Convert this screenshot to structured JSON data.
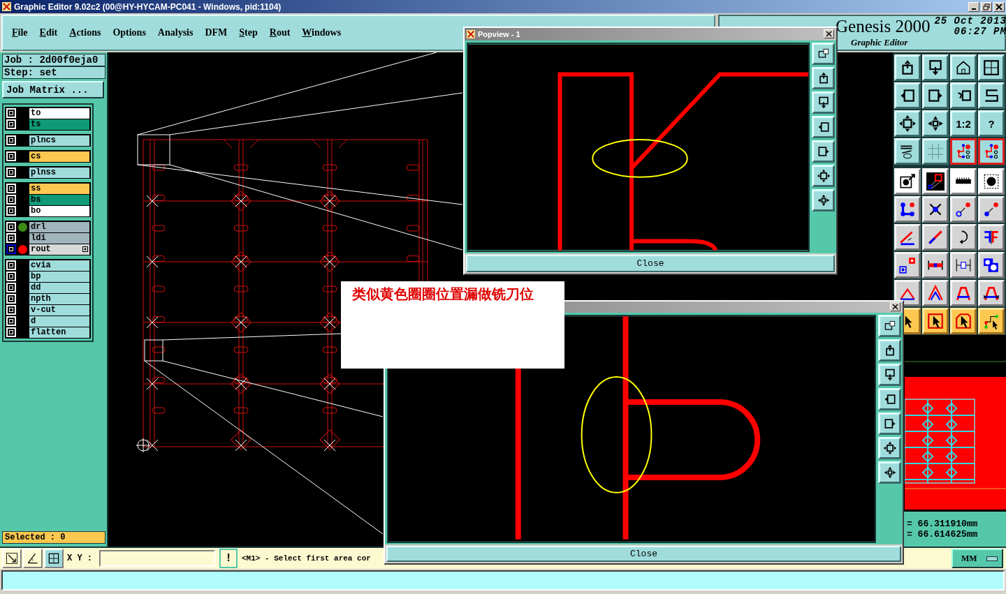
{
  "window": {
    "title": "Graphic Editor 9.02c2 (00@HY-HYCAM-PC041 - Windows, pid:1104)"
  },
  "menu": [
    {
      "label": "File",
      "mnemonic": true
    },
    {
      "label": "Edit",
      "mnemonic": true
    },
    {
      "label": "Actions",
      "mnemonic": true
    },
    {
      "label": "Options",
      "mnemonic": false
    },
    {
      "label": "Analysis",
      "mnemonic": false
    },
    {
      "label": "DFM",
      "mnemonic": false
    },
    {
      "label": "Step",
      "mnemonic": true
    },
    {
      "label": "Rout",
      "mnemonic": true
    },
    {
      "label": "Windows",
      "mnemonic": true
    }
  ],
  "header": {
    "product": "Genesis 2000",
    "date": "25 Oct 2013",
    "time": "06:27 PM",
    "subtitle": "Graphic Editor"
  },
  "job": {
    "job": "Job : 2d00f0eja0",
    "step": "Step: set",
    "matrix_button": "Job Matrix ..."
  },
  "layer_groups": [
    {
      "layers": [
        {
          "name": "to",
          "color": "#ffffff",
          "selected": false,
          "expandable": false
        },
        {
          "name": "ts",
          "color": "#109a78",
          "selected": false,
          "expandable": false
        }
      ]
    },
    {
      "layers": [
        {
          "name": "plncs",
          "color": "#a0dcdc",
          "selected": false,
          "expandable": false
        }
      ]
    },
    {
      "layers": [
        {
          "name": "cs",
          "color": "#fcc850",
          "selected": false,
          "expandable": false
        }
      ]
    },
    {
      "layers": [
        {
          "name": "plnss",
          "color": "#a0dcdc",
          "selected": false,
          "expandable": false
        }
      ]
    },
    {
      "layers": [
        {
          "name": "ss",
          "color": "#fcc850",
          "selected": false,
          "expandable": false
        },
        {
          "name": "bs",
          "color": "#109a78",
          "selected": false,
          "expandable": false
        },
        {
          "name": "bo",
          "color": "#ffffff",
          "selected": false,
          "expandable": false
        }
      ]
    },
    {
      "layers": [
        {
          "name": "drl",
          "color": "#a0b4bc",
          "marker": {
            "color": "#3c8c14"
          },
          "selected": false,
          "expandable": false
        },
        {
          "name": "ldi",
          "color": "#a0b4bc",
          "selected": false,
          "expandable": false
        },
        {
          "name": "rout",
          "color": "#d8d8d8",
          "marker": {
            "color": "#ff0000"
          },
          "selected": true,
          "expandable": true
        }
      ]
    },
    {
      "layers": [
        {
          "name": "cvia",
          "color": "#a0dcdc",
          "selected": false,
          "expandable": false
        },
        {
          "name": "bp",
          "color": "#a0dcdc",
          "selected": false,
          "expandable": false
        },
        {
          "name": "dd",
          "color": "#a0dcdc",
          "selected": false,
          "expandable": false
        },
        {
          "name": "npth",
          "color": "#a0dcdc",
          "selected": false,
          "expandable": false
        },
        {
          "name": "v-cut",
          "color": "#a0dcdc",
          "selected": false,
          "expandable": false
        },
        {
          "name": "d",
          "color": "#a0dcdc",
          "selected": false,
          "expandable": false
        },
        {
          "name": "flatten",
          "color": "#a0dcdc",
          "selected": false,
          "expandable": false
        }
      ]
    }
  ],
  "selected_count": "Selected : 0",
  "toolbar": [
    {
      "kind": "teal"
    },
    {
      "kind": "teal"
    },
    {
      "kind": "teal"
    },
    {
      "kind": "teal"
    },
    {
      "kind": "teal"
    },
    {
      "kind": "teal"
    },
    {
      "kind": "teal"
    },
    {
      "kind": "teal"
    },
    {
      "kind": "teal"
    },
    {
      "kind": "teal"
    },
    {
      "kind": "teal",
      "label": "1:2"
    },
    {
      "kind": "teal",
      "label": "?"
    },
    {
      "kind": "teal"
    },
    {
      "kind": "teal"
    },
    {
      "kind": "red"
    },
    {
      "kind": "red"
    },
    {
      "kind": "white"
    },
    {
      "kind": "white"
    },
    {
      "kind": "white"
    },
    {
      "kind": "white"
    },
    {
      "kind": "gray"
    },
    {
      "kind": "gray"
    },
    {
      "kind": "gray"
    },
    {
      "kind": "gray"
    },
    {
      "kind": "gray"
    },
    {
      "kind": "gray"
    },
    {
      "kind": "gray"
    },
    {
      "kind": "gray"
    },
    {
      "kind": "gray"
    },
    {
      "kind": "gray"
    },
    {
      "kind": "gray"
    },
    {
      "kind": "gray"
    },
    {
      "kind": "gray"
    },
    {
      "kind": "gray"
    },
    {
      "kind": "gray"
    },
    {
      "kind": "gray"
    },
    {
      "kind": "yellow"
    },
    {
      "kind": "yellow"
    },
    {
      "kind": "yellow"
    },
    {
      "kind": "yellow"
    }
  ],
  "coordinates": [
    "= 66.311910mm",
    "= 66.614625mm"
  ],
  "status": {
    "xy_label": "X Y :",
    "alert_button": "!",
    "message": "<M1> - Select first area cor",
    "units": "MM"
  },
  "popviews": [
    {
      "title": "Popview - 1",
      "close": "Close"
    },
    {
      "close": "Close"
    }
  ],
  "annotation": "类似黄色圈圈位置漏做铣刀位"
}
